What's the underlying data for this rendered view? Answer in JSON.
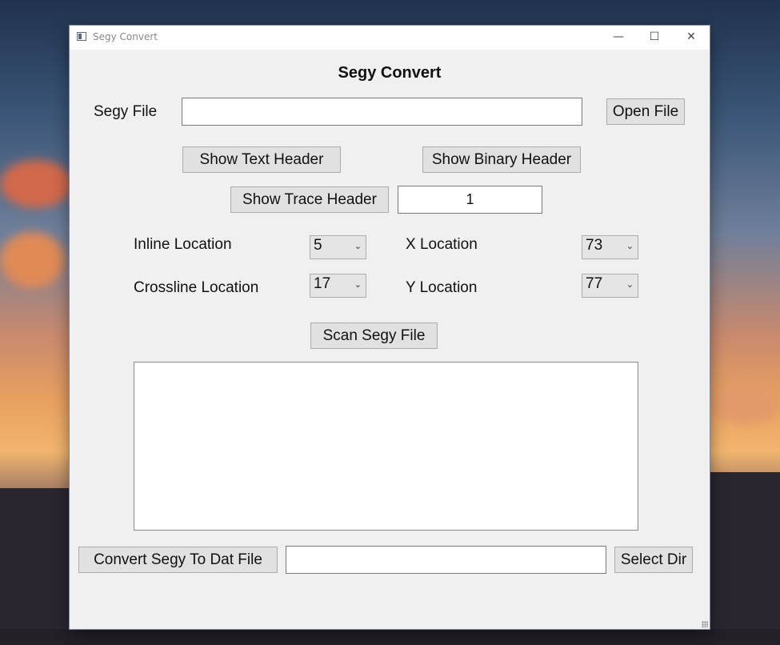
{
  "window": {
    "title": "Segy Convert",
    "controls": {
      "minimize": "—",
      "maximize": "☐",
      "close": "✕"
    }
  },
  "main": {
    "heading": "Segy Convert",
    "segy_file": {
      "label": "Segy File",
      "value": "",
      "open_button": "Open File"
    },
    "show_text_header": "Show Text Header",
    "show_binary_header": "Show Binary Header",
    "show_trace_header": "Show Trace Header",
    "trace_number": "1",
    "inline_location": {
      "label": "Inline Location",
      "value": "5"
    },
    "crossline_location": {
      "label": "Crossline Location",
      "value": "17"
    },
    "x_location": {
      "label": "X Location",
      "value": "73"
    },
    "y_location": {
      "label": "Y Location",
      "value": "77"
    },
    "scan_button": "Scan Segy File",
    "output_text": "",
    "convert_button": "Convert Segy To Dat File",
    "output_dir": "",
    "select_dir_button": "Select Dir"
  },
  "icons": {
    "dropdown": "chevron-down-icon",
    "app": "app-window-icon"
  },
  "colors": {
    "window_bg": "#f0f0f0",
    "button_bg": "#e1e1e1",
    "titlebar_bg": "#ffffff"
  }
}
